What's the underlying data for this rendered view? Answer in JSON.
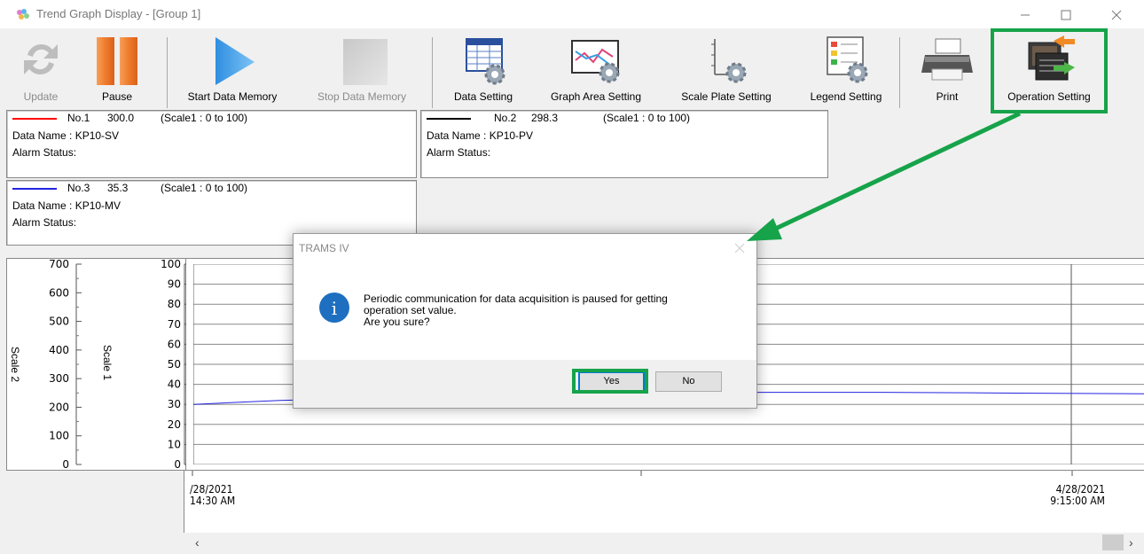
{
  "window": {
    "title": "Trend Graph Display - [Group 1]",
    "controls": [
      "minimize-icon",
      "maximize-icon",
      "close-icon"
    ]
  },
  "toolbar": {
    "update": "Update",
    "pause": "Pause",
    "start_data_memory": "Start Data Memory",
    "stop_data_memory": "Stop Data Memory",
    "data_setting": "Data Setting",
    "graph_area_setting": "Graph Area Setting",
    "scale_plate_setting": "Scale Plate Setting",
    "legend_setting": "Legend Setting",
    "print": "Print",
    "operation_setting": "Operation Setting"
  },
  "legends": [
    {
      "no": "No.1",
      "value": "300.0",
      "scale": "(Scale1 : 0  to  100)",
      "data_name": "Data Name :  KP10-SV",
      "alarm": "Alarm Status:",
      "color": "#ff0000"
    },
    {
      "no": "No.2",
      "value": "298.3",
      "scale": "(Scale1 : 0  to  100)",
      "data_name": "Data Name :  KP10-PV",
      "alarm": "Alarm Status:",
      "color": "#000000"
    },
    {
      "no": "No.3",
      "value": "35.3",
      "scale": "(Scale1 : 0  to  100)",
      "data_name": "Data Name :  KP10-MV",
      "alarm": "Alarm Status:",
      "color": "#2323e0"
    }
  ],
  "scale2": {
    "title": "Scale 2",
    "ticks": [
      "700",
      "600",
      "500",
      "400",
      "300",
      "200",
      "100",
      "0"
    ]
  },
  "scale1": {
    "title": "Scale 1",
    "ticks": [
      "100",
      "90",
      "80",
      "70",
      "60",
      "50",
      "40",
      "30",
      "20",
      "10",
      "0"
    ]
  },
  "time_axis": {
    "left": {
      "line1": "/28/2021",
      "line2": "14:30 AM"
    },
    "right": {
      "line1": "4/28/2021",
      "line2": "9:15:00 AM"
    }
  },
  "chart_data": {
    "type": "line",
    "series": [
      {
        "color": "#2323e0",
        "values_scale1": [
          30,
          32,
          33,
          34,
          35,
          35.5,
          36,
          36,
          36,
          35.8,
          35.5,
          35.3
        ]
      }
    ],
    "ylim_scale1": [
      0,
      100
    ],
    "ylim_scale2": [
      0,
      700
    ]
  },
  "dialog": {
    "title": "TRAMS IV",
    "message_line1": "Periodic communication for data acquisition is paused for getting",
    "message_line2": "operation set value.",
    "message_line3": "Are you sure?",
    "yes": "Yes",
    "no": "No"
  },
  "annotation_color": "#16a34a"
}
